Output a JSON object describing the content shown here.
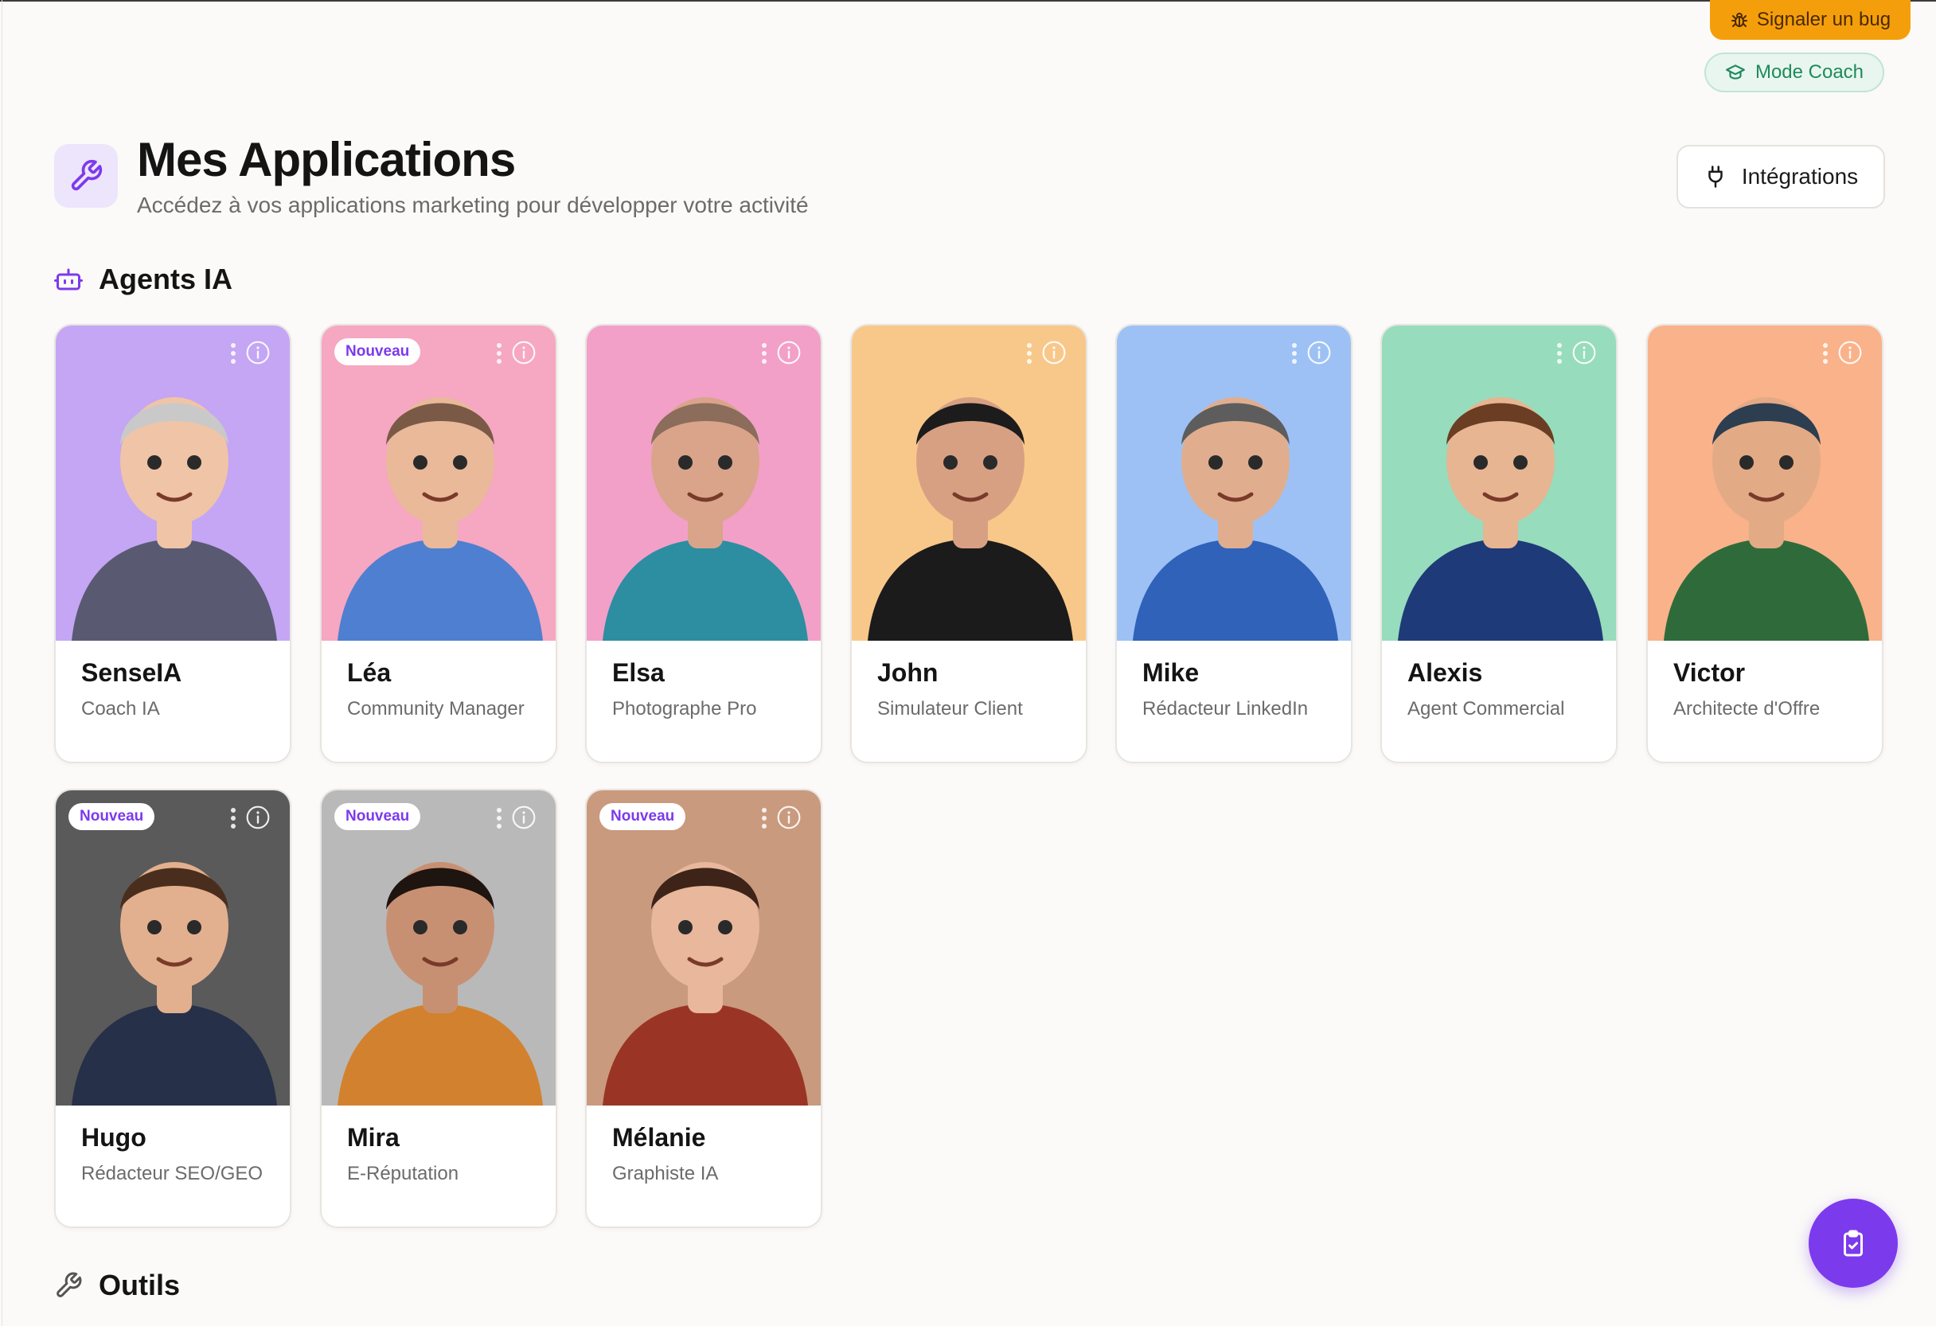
{
  "top_actions": {
    "bug_label": "Signaler un bug",
    "coach_label": "Mode Coach"
  },
  "header": {
    "title": "Mes Applications",
    "subtitle": "Accédez à vos applications marketing pour développer votre activité",
    "integrations_label": "Intégrations"
  },
  "sections": {
    "agents_title": "Agents IA",
    "tools_title": "Outils"
  },
  "agents": [
    {
      "name": "SenseIA",
      "role": "Coach IA",
      "badge": "",
      "bg": "#c4a6f4"
    },
    {
      "name": "Léa",
      "role": "Community Manager",
      "badge": "Nouveau",
      "bg": "#f6a7c1"
    },
    {
      "name": "Elsa",
      "role": "Photographe Pro",
      "badge": "",
      "bg": "#f2a0c8"
    },
    {
      "name": "John",
      "role": "Simulateur Client",
      "badge": "",
      "bg": "#f8c88a"
    },
    {
      "name": "Mike",
      "role": "Rédacteur LinkedIn",
      "badge": "",
      "bg": "#9dc1f5"
    },
    {
      "name": "Alexis",
      "role": "Agent Commercial",
      "badge": "",
      "bg": "#97dcbd"
    },
    {
      "name": "Victor",
      "role": "Architecte d'Offre",
      "badge": "",
      "bg": "#f9b28a"
    },
    {
      "name": "Hugo",
      "role": "Rédacteur SEO/GEO",
      "badge": "Nouveau",
      "bg": "#5a5a5a"
    },
    {
      "name": "Mira",
      "role": "E-Réputation",
      "badge": "Nouveau",
      "bg": "#b9b9b9"
    },
    {
      "name": "Mélanie",
      "role": "Graphiste IA",
      "badge": "Nouveau",
      "bg": "#c99a7e"
    }
  ],
  "colors": {
    "accent": "#7c3aed",
    "bug_bg": "#f59e0b",
    "coach_text": "#1f8a5b"
  },
  "icons": {
    "bug": "bug-icon",
    "coach": "graduation-cap-icon",
    "header": "wrench-icon",
    "integrations": "plug-icon",
    "agents": "robot-icon",
    "tools": "wrench-icon",
    "fab": "clipboard-check-icon"
  }
}
